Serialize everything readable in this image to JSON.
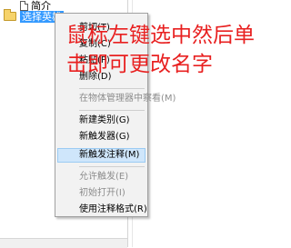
{
  "tree": {
    "child_label": "简介",
    "selected_label": "选择英雄"
  },
  "menu": {
    "items": [
      {
        "label": "剪切(T)",
        "disabled": false
      },
      {
        "label": "复制(C)",
        "disabled": false
      },
      {
        "label": "粘贴(P)",
        "disabled": false
      },
      {
        "label": "删除(D)",
        "disabled": false
      },
      {
        "label": "在物体管理器中察看(M)",
        "disabled": true
      },
      {
        "label": "新建类别(G)",
        "disabled": false
      },
      {
        "label": "新触发器(G)",
        "disabled": false
      },
      {
        "label": "新触发注释(M)",
        "disabled": false,
        "highlighted": true
      },
      {
        "label": "允许触发(E)",
        "disabled": true
      },
      {
        "label": "初始打开(I)",
        "disabled": true
      },
      {
        "label": "使用注释格式(R)",
        "disabled": false
      }
    ]
  },
  "annotation": {
    "line1": "鼠标左键选中然后单",
    "line2": "击即可更改名字",
    "color": "#e82020"
  }
}
